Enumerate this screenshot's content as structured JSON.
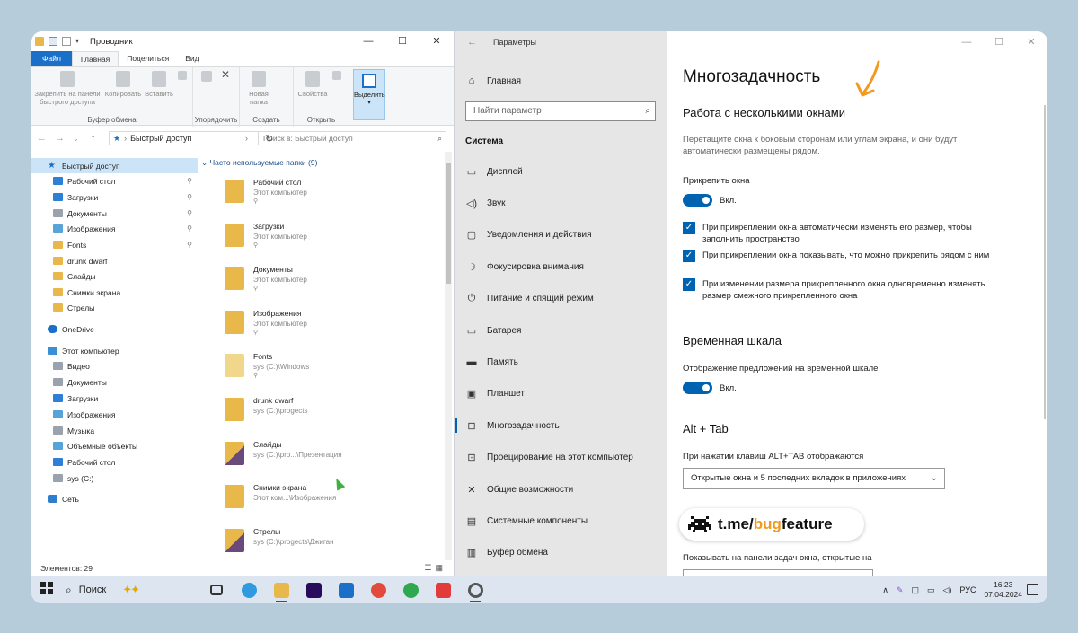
{
  "explorer": {
    "title": "Проводник",
    "tabs": [
      "Файл",
      "Главная",
      "Поделиться",
      "Вид"
    ],
    "ribbon": {
      "pin_label": "Закрепить на панели быстрого доступа",
      "copy_label": "Копировать",
      "paste_label": "Вставить",
      "group_clipboard": "Буфер обмена",
      "group_organize": "Упорядочить",
      "new_folder_label": "Новая папка",
      "group_create": "Создать",
      "properties_label": "Свойства",
      "group_open": "Открыть",
      "select_label": "Выделить"
    },
    "address": "Быстрый доступ",
    "search_placeholder": "Поиск в: Быстрый доступ",
    "nav": [
      {
        "label": "Быстрый доступ",
        "icon": "star",
        "pinned": false
      },
      {
        "label": "Рабочий стол",
        "icon": "blue",
        "pinned": true
      },
      {
        "label": "Загрузки",
        "icon": "blue",
        "pinned": true
      },
      {
        "label": "Документы",
        "icon": "gray",
        "pinned": true
      },
      {
        "label": "Изображения",
        "icon": "img",
        "pinned": true
      },
      {
        "label": "Fonts",
        "icon": "folder",
        "pinned": true
      },
      {
        "label": "drunk dwarf",
        "icon": "folder",
        "pinned": false
      },
      {
        "label": "Слайды",
        "icon": "folder",
        "pinned": false
      },
      {
        "label": "Снимки экрана",
        "icon": "folder",
        "pinned": false
      },
      {
        "label": "Стрелы",
        "icon": "folder",
        "pinned": false
      },
      {
        "label": "OneDrive",
        "icon": "cloud",
        "pinned": false
      },
      {
        "label": "Этот компьютер",
        "icon": "pc",
        "pinned": false
      },
      {
        "label": "Видео",
        "icon": "gray",
        "pinned": false
      },
      {
        "label": "Документы",
        "icon": "gray",
        "pinned": false
      },
      {
        "label": "Загрузки",
        "icon": "blue",
        "pinned": false
      },
      {
        "label": "Изображения",
        "icon": "img",
        "pinned": false
      },
      {
        "label": "Музыка",
        "icon": "gray",
        "pinned": false
      },
      {
        "label": "Объемные объекты",
        "icon": "img",
        "pinned": false
      },
      {
        "label": "Рабочий стол",
        "icon": "blue",
        "pinned": false
      },
      {
        "label": "sys (C:)",
        "icon": "gray",
        "pinned": false
      },
      {
        "label": "Сеть",
        "icon": "net",
        "pinned": false
      }
    ],
    "section_header": "Часто используемые папки (9)",
    "folders": [
      {
        "name": "Рабочий стол",
        "sub": "Этот компьютер",
        "pinned": true,
        "icon": "folder"
      },
      {
        "name": "Загрузки",
        "sub": "Этот компьютер",
        "pinned": true,
        "icon": "folder"
      },
      {
        "name": "Документы",
        "sub": "Этот компьютер",
        "pinned": true,
        "icon": "folder"
      },
      {
        "name": "Изображения",
        "sub": "Этот компьютер",
        "pinned": true,
        "icon": "folder"
      },
      {
        "name": "Fonts",
        "sub": "sys (C:)\\Windows",
        "pinned": true,
        "icon": "fonts"
      },
      {
        "name": "drunk dwarf",
        "sub": "sys (C:)\\progects",
        "pinned": false,
        "icon": "folder"
      },
      {
        "name": "Слайды",
        "sub": "sys (C:)\\pro...\\Презентация",
        "pinned": false,
        "icon": "pic"
      },
      {
        "name": "Снимки экрана",
        "sub": "Этот ком...\\Изображения",
        "pinned": false,
        "icon": "folder"
      },
      {
        "name": "Стрелы",
        "sub": "sys (C:)\\progects\\Джиган",
        "pinned": false,
        "icon": "pic"
      }
    ],
    "status": "Элементов: 29"
  },
  "settings": {
    "title": "Параметры",
    "home": "Главная",
    "search_placeholder": "Найти параметр",
    "category": "Система",
    "items": [
      {
        "label": "Дисплей",
        "icon": "▭"
      },
      {
        "label": "Звук",
        "icon": "◁)"
      },
      {
        "label": "Уведомления и действия",
        "icon": "▢"
      },
      {
        "label": "Фокусировка внимания",
        "icon": "☽"
      },
      {
        "label": "Питание и спящий режим",
        "icon": "⏻"
      },
      {
        "label": "Батарея",
        "icon": "▭"
      },
      {
        "label": "Память",
        "icon": "▬"
      },
      {
        "label": "Планшет",
        "icon": "▣"
      },
      {
        "label": "Многозадачность",
        "icon": "⊟"
      },
      {
        "label": "Проецирование на этот компьютер",
        "icon": "⊡"
      },
      {
        "label": "Общие возможности",
        "icon": "✕"
      },
      {
        "label": "Системные компоненты",
        "icon": "▤"
      },
      {
        "label": "Буфер обмена",
        "icon": "▥"
      }
    ],
    "active_index": 8,
    "page_title": "Многозадачность",
    "snap": {
      "header": "Работа с несколькими окнами",
      "desc": "Перетащите окна к боковым сторонам или углам экрана, и они будут автоматически размещены рядом.",
      "toggle_label": "Прикрепить окна",
      "toggle_state": "Вкл.",
      "options": [
        "При прикреплении окна автоматически изменять его размер, чтобы заполнить пространство",
        "При прикреплении окна показывать, что можно прикрепить рядом с ним",
        "При изменении размера прикрепленного окна одновременно изменять размер смежного прикрепленного окна"
      ]
    },
    "timeline": {
      "header": "Временная шкала",
      "toggle_label": "Отображение предложений на временной шкале",
      "toggle_state": "Вкл."
    },
    "alttab": {
      "header": "Alt + Tab",
      "label": "При нажатии клавиш ALT+TAB отображаются",
      "value": "Открытые окна и 5 последних вкладок в приложениях"
    },
    "taskbar_label": "Показывать на панели задач окна, открытые на"
  },
  "badge": {
    "prefix": "t.me/",
    "accent": "bug",
    "suffix": "feature",
    "accent_color": "#f39a1e"
  },
  "taskbar": {
    "search_label": "Поиск",
    "lang": "РУС",
    "time": "16:23",
    "date": "07.04.2024",
    "apps": [
      {
        "name": "task-view",
        "color": "#333333"
      },
      {
        "name": "edge",
        "color": "#2f9ae0"
      },
      {
        "name": "explorer",
        "color": "#e8b94a"
      },
      {
        "name": "after-effects",
        "color": "#2a0a5a"
      },
      {
        "name": "mail",
        "color": "#1a6fc9"
      },
      {
        "name": "chrome",
        "color": "#e24b3b"
      },
      {
        "name": "chrome",
        "color": "#2fa84f"
      },
      {
        "name": "anydesk",
        "color": "#e23b3b"
      },
      {
        "name": "settings",
        "color": "#555555"
      }
    ]
  }
}
